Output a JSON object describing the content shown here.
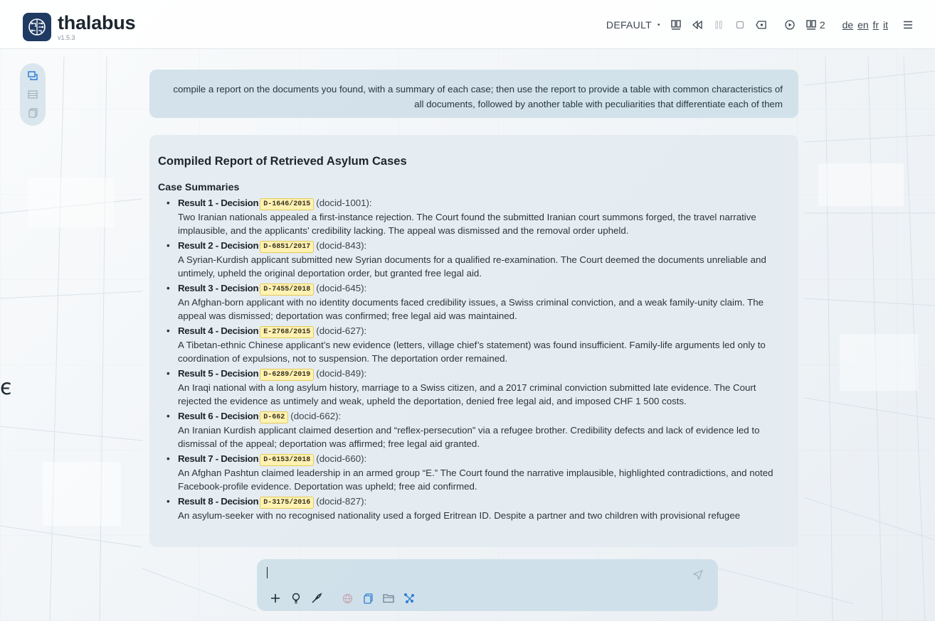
{
  "app": {
    "name": "thalabus",
    "version": "v1.5.3"
  },
  "header": {
    "mode": "DEFAULT",
    "count": "2",
    "languages": [
      "de",
      "en",
      "fr",
      "it"
    ],
    "icons": [
      "documents-icon",
      "rewind-icon",
      "pause-icon",
      "stop-icon",
      "backspace-icon",
      "play-circle-icon",
      "documents-count-icon",
      "menu-icon"
    ]
  },
  "sidebar": {
    "items": [
      "chat-icon",
      "list-icon",
      "documents-icon"
    ]
  },
  "edge_glyph": "є",
  "query": {
    "text": "compile a report on the documents you found, with a summary of each case; then use the report to provide a table with common characteristics of all documents, followed by another table with peculiarities that differentiate each of them"
  },
  "response": {
    "title": "Compiled Report of Retrieved Asylum Cases",
    "section": "Case Summaries",
    "results": [
      {
        "label": "Result 1 - Decision",
        "decision": "D-1646/2015",
        "docid": "(docid-1001):",
        "summary": "Two Iranian nationals appealed a first-instance rejection. The Court found the submitted Iranian court summons forged, the travel narrative implausible, and the applicants’ credibility lacking. The appeal was dismissed and the removal order upheld."
      },
      {
        "label": "Result 2 - Decision",
        "decision": "D-6851/2017",
        "docid": "(docid-843):",
        "summary": "A Syrian-Kurdish applicant submitted new Syrian documents for a qualified re-examination. The Court deemed the documents unreliable and untimely, upheld the original deportation order, but granted free legal aid."
      },
      {
        "label": "Result 3 - Decision",
        "decision": "D-7455/2018",
        "docid": "(docid-645):",
        "summary": "An Afghan-born applicant with no identity documents faced credibility issues, a Swiss criminal conviction, and a weak family-unity claim. The appeal was dismissed; deportation was confirmed; free legal aid was maintained."
      },
      {
        "label": "Result 4 - Decision",
        "decision": "E-2768/2015",
        "docid": "(docid-627):",
        "summary": "A Tibetan-ethnic Chinese applicant’s new evidence (letters, village chief’s statement) was found insufficient. Family-life arguments led only to coordination of expulsions, not to suspension. The deportation order remained."
      },
      {
        "label": "Result 5 - Decision",
        "decision": "D-6289/2019",
        "docid": "(docid-849):",
        "summary": "An Iraqi national with a long asylum history, marriage to a Swiss citizen, and a 2017 criminal conviction submitted late evidence. The Court rejected the evidence as untimely and weak, upheld the deportation, denied free legal aid, and imposed CHF 1 500 costs."
      },
      {
        "label": "Result 6 - Decision",
        "decision": "D-662",
        "docid": "(docid-662):",
        "summary": "An Iranian Kurdish applicant claimed desertion and “reflex-persecution” via a refugee brother. Credibility defects and lack of evidence led to dismissal of the appeal; deportation was affirmed; free legal aid granted."
      },
      {
        "label": "Result 7 - Decision",
        "decision": "D-6153/2018",
        "docid": "(docid-660):",
        "summary": "An Afghan Pashtun claimed leadership in an armed group “E.” The Court found the narrative implausible, highlighted contradictions, and noted Facebook-profile evidence. Deportation was upheld; free aid confirmed."
      },
      {
        "label": "Result 8 - Decision",
        "decision": "D-3175/2016",
        "docid": "(docid-827):",
        "summary": "An asylum-seeker with no recognised nationality used a forged Eritrean ID. Despite a partner and two children with provisional refugee"
      }
    ]
  },
  "composer": {
    "value": "",
    "tools": [
      "plus-icon",
      "lightbulb-icon",
      "nib-icon",
      "globe-icon",
      "document-icon",
      "folder-icon",
      "network-icon"
    ]
  },
  "colors": {
    "accent": "#2a7fd4",
    "badge_bg": "#fff2b3",
    "badge_border": "#e6cc55",
    "card": "#e2eaf0"
  }
}
